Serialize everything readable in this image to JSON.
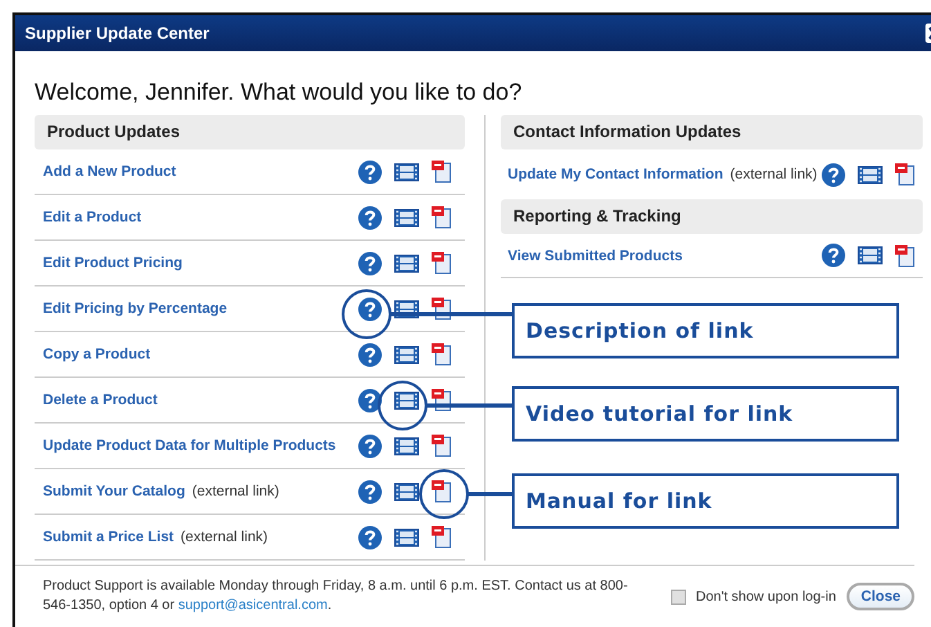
{
  "window": {
    "title": "Supplier Update Center"
  },
  "heading": "Welcome, Jennifer. What would you like to do?",
  "left_sections": [
    {
      "title": "Product Updates",
      "items": [
        {
          "label": "Add a New Product"
        },
        {
          "label": "Edit a Product"
        },
        {
          "label": "Edit Product Pricing"
        },
        {
          "label": "Edit Pricing by Percentage"
        },
        {
          "label": "Copy a Product"
        },
        {
          "label": "Delete a Product"
        },
        {
          "label": "Update Product Data for Multiple Products"
        },
        {
          "label": "Submit Your Catalog",
          "note": "(external link)"
        },
        {
          "label": "Submit a Price List",
          "note": "(external link)"
        }
      ]
    }
  ],
  "right_sections": [
    {
      "title": "Contact Information Updates",
      "items": [
        {
          "label": "Update My Contact Information",
          "note": "(external link)"
        }
      ]
    },
    {
      "title": "Reporting & Tracking",
      "items": [
        {
          "label": "View Submitted Products"
        }
      ]
    }
  ],
  "callouts": [
    {
      "label": "Description of link"
    },
    {
      "label": "Video tutorial for link"
    },
    {
      "label": "Manual for link"
    }
  ],
  "footer": {
    "text_before": "Product Support is available Monday through Friday, 8 a.m. until 6 p.m. EST. Contact us at 800-546-1350, option 4 or ",
    "link": "support@asicentral.com",
    "text_after": "."
  },
  "dont_show": {
    "label": "Don't show upon log-in",
    "checked": false
  },
  "close_button": "Close"
}
